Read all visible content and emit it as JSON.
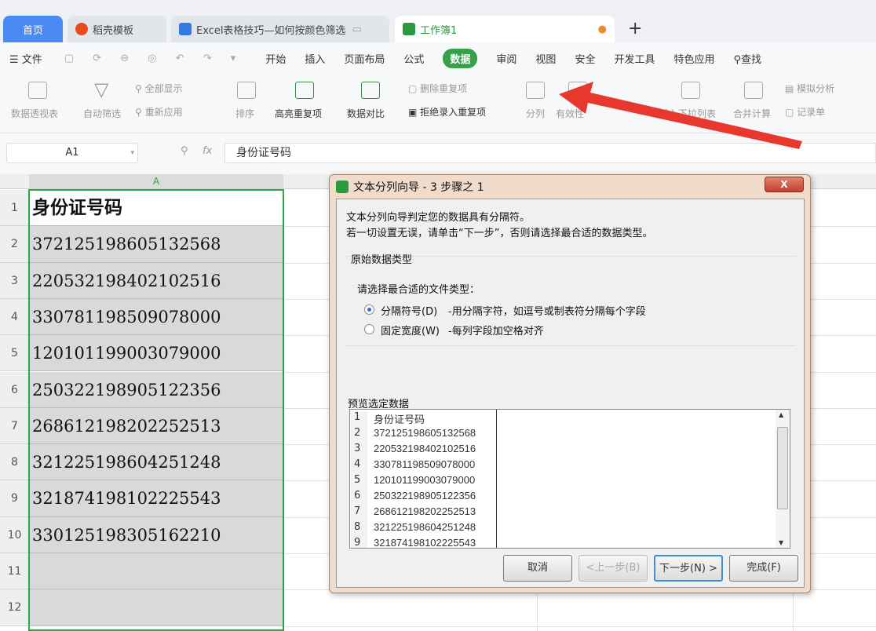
{
  "tabs": [
    {
      "label": "首页"
    },
    {
      "label": "稻壳模板"
    },
    {
      "label": "Excel表格技巧—如何按颜色筛选"
    },
    {
      "label": "工作簿1"
    }
  ],
  "new_tab": "+",
  "menu": {
    "file": "文件",
    "items": [
      "开始",
      "插入",
      "页面布局",
      "公式",
      "数据",
      "审阅",
      "视图",
      "安全",
      "开发工具",
      "特色应用"
    ],
    "search": "查找"
  },
  "ribbon": {
    "pivot": "数据透视表",
    "autofilter": "自动筛选",
    "show_all": "全部显示",
    "reapply": "重新应用",
    "sort": "排序",
    "highlight_dup": "高亮重复项",
    "compare": "数据对比",
    "remove_dup": "删除重复项",
    "reject_dup": "拒绝录入重复项",
    "split": "分列",
    "validity": "有效性",
    "dropdown": "插入下拉列表",
    "consolidate": "合并计算",
    "simulate": "模拟分析",
    "record": "记录单"
  },
  "formula": {
    "namebox": "A1",
    "fx": "fx",
    "value": "身份证号码"
  },
  "sheet": {
    "col": "A",
    "rows": [
      "1",
      "2",
      "3",
      "4",
      "5",
      "6",
      "7",
      "8",
      "9",
      "10",
      "11",
      "12"
    ],
    "cells": [
      "身份证号码",
      "372125198605132568",
      "220532198402102516",
      "330781198509078000",
      "120101199003079000",
      "250322198905122356",
      "268612198202252513",
      "321225198604251248",
      "321874198102225543",
      "330125198305162210",
      "",
      ""
    ]
  },
  "dialog": {
    "title": "文本分列向导 - 3 步骤之 1",
    "close": "X",
    "line1": "文本分列向导判定您的数据具有分隔符。",
    "line2": "若一切设置无误，请单击“下一步”，否则请选择最合适的数据类型。",
    "group": "原始数据类型",
    "prompt": "请选择最合适的文件类型：",
    "opt1": "分隔符号(D)",
    "opt1_desc": "-用分隔字符，如逗号或制表符分隔每个字段",
    "opt2": "固定宽度(W)",
    "opt2_desc": "-每列字段加空格对齐",
    "preview_label": "预览选定数据",
    "preview": [
      {
        "n": "1",
        "v": "身份证号码"
      },
      {
        "n": "2",
        "v": "372125198605132568"
      },
      {
        "n": "3",
        "v": "220532198402102516"
      },
      {
        "n": "4",
        "v": "330781198509078000"
      },
      {
        "n": "5",
        "v": "120101199003079000"
      },
      {
        "n": "6",
        "v": "250322198905122356"
      },
      {
        "n": "7",
        "v": "268612198202252513"
      },
      {
        "n": "8",
        "v": "321225198604251248"
      },
      {
        "n": "9",
        "v": "321874198102225543"
      }
    ],
    "cancel": "取消",
    "back": "<上一步(B)",
    "next": "下一步(N) >",
    "finish": "完成(F)"
  },
  "colors": {
    "accent": "#37a14a",
    "arrow": "#e8372c"
  }
}
